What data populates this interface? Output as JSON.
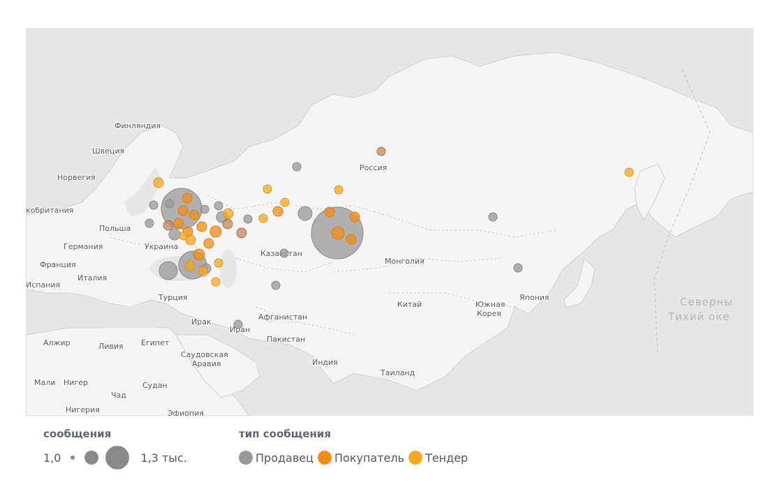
{
  "map": {
    "country_labels": [
      {
        "id": "finland",
        "text": "Финляндия"
      },
      {
        "id": "sweden",
        "text": "Швеция"
      },
      {
        "id": "norway",
        "text": "Норвегия"
      },
      {
        "id": "uk",
        "text": "кобритания"
      },
      {
        "id": "poland",
        "text": "Польша"
      },
      {
        "id": "germany",
        "text": "Германия"
      },
      {
        "id": "ukraine",
        "text": "Украина"
      },
      {
        "id": "france",
        "text": "Франция"
      },
      {
        "id": "italy",
        "text": "Италия"
      },
      {
        "id": "spain",
        "text": "Испания"
      },
      {
        "id": "turkey",
        "text": "Турция"
      },
      {
        "id": "iraq",
        "text": "Ирак"
      },
      {
        "id": "iran",
        "text": "Иран"
      },
      {
        "id": "afghanistan",
        "text": "Афганистан"
      },
      {
        "id": "pakistan",
        "text": "Пакистан"
      },
      {
        "id": "india",
        "text": "Индия"
      },
      {
        "id": "thailand",
        "text": "Таиланд"
      },
      {
        "id": "china",
        "text": "Китай"
      },
      {
        "id": "mongolia",
        "text": "Монголия"
      },
      {
        "id": "kazakhstan",
        "text": "Казахстан"
      },
      {
        "id": "russia",
        "text": "Россия"
      },
      {
        "id": "south_korea_1",
        "text": "Южная"
      },
      {
        "id": "south_korea_2",
        "text": "Корея"
      },
      {
        "id": "japan",
        "text": "Япония"
      },
      {
        "id": "algeria",
        "text": "Алжир"
      },
      {
        "id": "libya",
        "text": "Ливия"
      },
      {
        "id": "egypt",
        "text": "Египет"
      },
      {
        "id": "saudi_1",
        "text": "Саудовская"
      },
      {
        "id": "saudi_2",
        "text": "Аравия"
      },
      {
        "id": "mali",
        "text": "Мали"
      },
      {
        "id": "niger",
        "text": "Нигер"
      },
      {
        "id": "chad",
        "text": "Чад"
      },
      {
        "id": "sudan",
        "text": "Судан"
      },
      {
        "id": "nigeria",
        "text": "Нигерия"
      },
      {
        "id": "ethiopia",
        "text": "Эфиопия"
      }
    ],
    "ocean_labels": [
      {
        "id": "pacific_1",
        "text": "Северны"
      },
      {
        "id": "pacific_2",
        "text": "Тихий оке"
      }
    ]
  },
  "legend": {
    "size_title": "сообщения",
    "size_min": "1,0",
    "size_max": "1,3 тыс.",
    "type_title": "тип сообщения",
    "types": [
      {
        "label": "Продавец",
        "color": "#9a9a9a"
      },
      {
        "label": "Покупатель",
        "color": "#f28c1a"
      },
      {
        "label": "Тендер",
        "color": "#f7a823"
      }
    ]
  },
  "colors": {
    "seller": "#9a9a9a",
    "buyer": "#f28c1a",
    "tender": "#f7a823",
    "mixed": "#c08a60"
  }
}
